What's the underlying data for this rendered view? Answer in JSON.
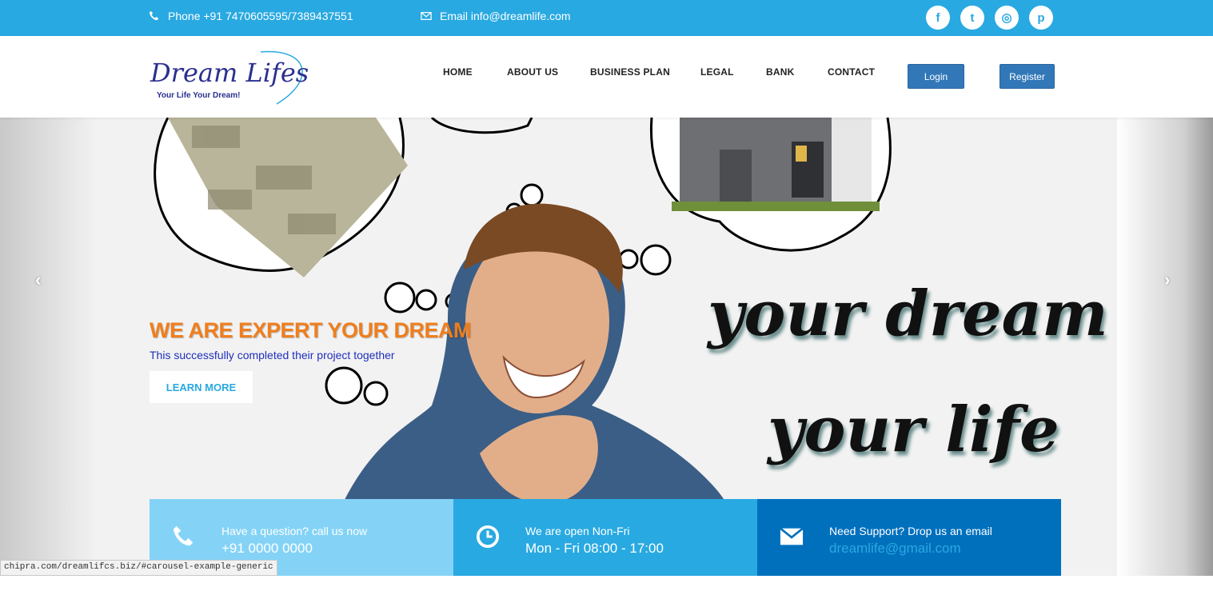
{
  "topbar": {
    "phone": "Phone +91 7470605595/7389437551",
    "email": "Email info@dreamlife.com",
    "social": [
      {
        "icon": "facebook-icon",
        "glyph": "f"
      },
      {
        "icon": "twitter-icon",
        "glyph": "t"
      },
      {
        "icon": "instagram-icon",
        "glyph": "◎"
      },
      {
        "icon": "pinterest-icon",
        "glyph": "p"
      }
    ]
  },
  "logo": {
    "title": "Dream Lifes",
    "tagline": "Your Life   Your Dream!"
  },
  "nav": {
    "items": [
      "HOME",
      "ABOUT US",
      "BUSINESS PLAN",
      "LEGAL",
      "BANK",
      "CONTACT"
    ],
    "login": "Login",
    "register": "Register"
  },
  "hero": {
    "headline": "WE ARE EXPERT YOUR DREAM",
    "subline": "This successfully completed their project together",
    "cta": "LEARN MORE",
    "script_line1": "your dream",
    "script_line2": "your life",
    "prev": "‹",
    "next": "›"
  },
  "info": [
    {
      "label": "Have a question? call us now",
      "value": "+91 0000 0000",
      "icon": "phone-icon",
      "color": "#84d3f7"
    },
    {
      "label": "We are open Non-Fri",
      "value": "Mon - Fri 08:00 - 17:00",
      "icon": "clock-icon",
      "color": "#29a9e1"
    },
    {
      "label": "Need Support? Drop us an email",
      "value": "dreamlife@gmail.com",
      "icon": "envelope-icon",
      "color": "#0070bd"
    }
  ],
  "status_url": "chipra.com/dreamlifcs.biz/#carousel-example-generic",
  "colors": {
    "accent": "#29a9e1",
    "orange": "#f07e1c",
    "button": "#3278b8"
  }
}
